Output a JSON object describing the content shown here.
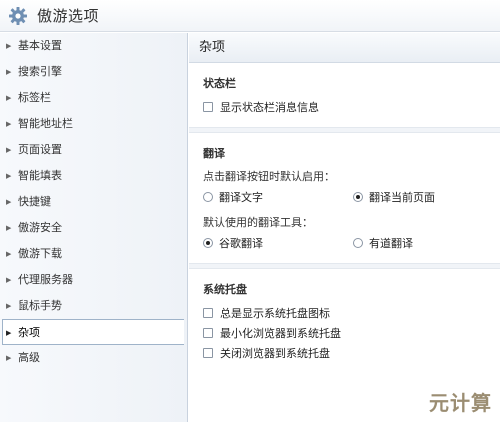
{
  "window": {
    "title": "傲游选项",
    "icon": "gear-icon"
  },
  "sidebar": {
    "items": [
      {
        "label": "基本设置",
        "selected": false
      },
      {
        "label": "搜索引擎",
        "selected": false
      },
      {
        "label": "标签栏",
        "selected": false
      },
      {
        "label": "智能地址栏",
        "selected": false
      },
      {
        "label": "页面设置",
        "selected": false
      },
      {
        "label": "智能填表",
        "selected": false
      },
      {
        "label": "快捷键",
        "selected": false
      },
      {
        "label": "傲游安全",
        "selected": false
      },
      {
        "label": "傲游下载",
        "selected": false
      },
      {
        "label": "代理服务器",
        "selected": false
      },
      {
        "label": "鼠标手势",
        "selected": false
      },
      {
        "label": "杂项",
        "selected": true
      },
      {
        "label": "高级",
        "selected": false
      }
    ]
  },
  "main": {
    "header": "杂项",
    "statusbar": {
      "title": "状态栏",
      "options": [
        {
          "label": "显示状态栏消息信息",
          "checked": false
        }
      ]
    },
    "translate": {
      "title": "翻译",
      "button_prompt": "点击翻译按钮时默认启用：",
      "button_options": [
        {
          "label": "翻译文字",
          "selected": false
        },
        {
          "label": "翻译当前页面",
          "selected": true
        }
      ],
      "tool_prompt": "默认使用的翻译工具：",
      "tool_options": [
        {
          "label": "谷歌翻译",
          "selected": true
        },
        {
          "label": "有道翻译",
          "selected": false
        }
      ]
    },
    "tray": {
      "title": "系统托盘",
      "options": [
        {
          "label": "总是显示系统托盘图标",
          "checked": false
        },
        {
          "label": "最小化浏览器到系统托盘",
          "checked": false
        },
        {
          "label": "关闭浏览器到系统托盘",
          "checked": false
        }
      ]
    }
  },
  "watermark": "元计算"
}
